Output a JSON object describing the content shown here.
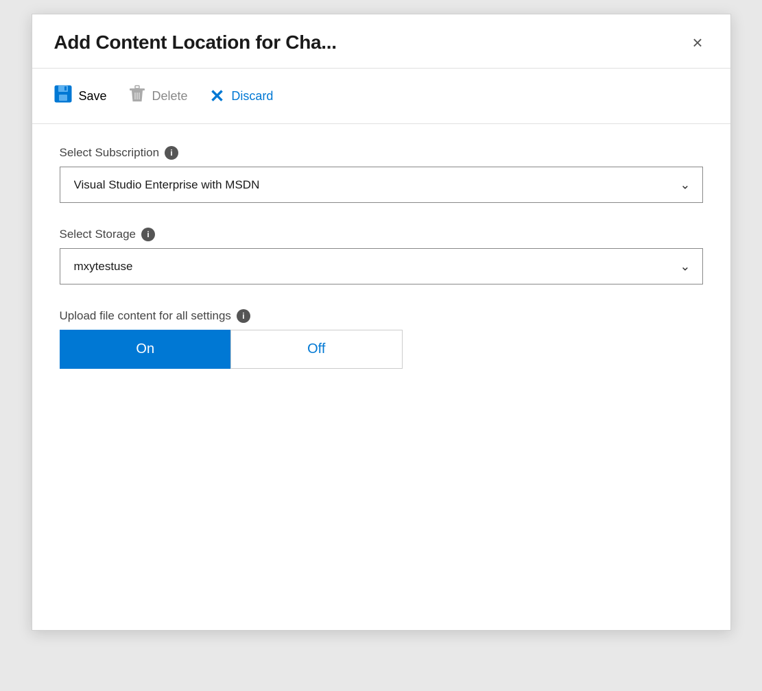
{
  "dialog": {
    "title": "Add Content Location for Cha...",
    "close_label": "×"
  },
  "toolbar": {
    "save_label": "Save",
    "delete_label": "Delete",
    "discard_label": "Discard"
  },
  "form": {
    "subscription": {
      "label": "Select Subscription",
      "value": "Visual Studio Enterprise with MSDN",
      "info_title": "Information about subscription"
    },
    "storage": {
      "label": "Select Storage",
      "value": "mxytestuse",
      "info_title": "Information about storage"
    },
    "upload": {
      "label": "Upload file content for all settings",
      "info_title": "Information about upload",
      "on_label": "On",
      "off_label": "Off",
      "selected": "on"
    }
  },
  "colors": {
    "blue": "#0078d4",
    "gray": "#888888",
    "dark": "#1a1a1a"
  }
}
